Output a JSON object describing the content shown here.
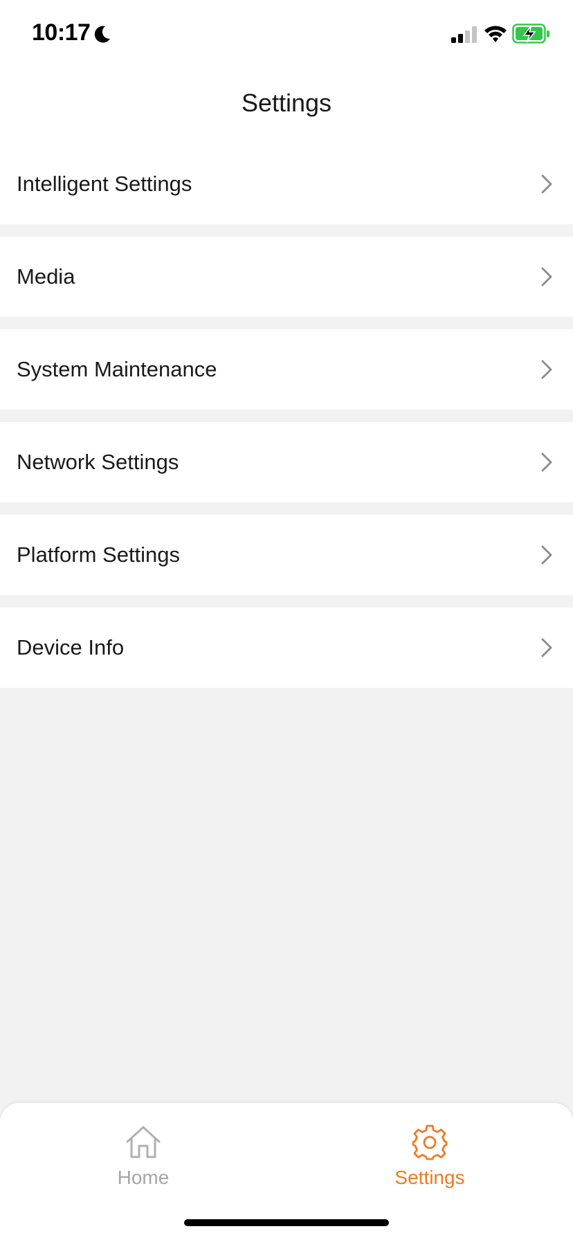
{
  "status_bar": {
    "time": "10:17",
    "icons": [
      "moon-icon",
      "signal-icon",
      "wifi-icon",
      "battery-charging-icon"
    ]
  },
  "header": {
    "title": "Settings"
  },
  "menu": {
    "items": [
      {
        "label": "Intelligent Settings"
      },
      {
        "label": "Media"
      },
      {
        "label": "System Maintenance"
      },
      {
        "label": "Network Settings"
      },
      {
        "label": "Platform Settings"
      },
      {
        "label": "Device Info"
      }
    ]
  },
  "tab_bar": {
    "tabs": [
      {
        "label": "Home",
        "icon": "home-icon",
        "active": false
      },
      {
        "label": "Settings",
        "icon": "gear-icon",
        "active": true
      }
    ]
  },
  "colors": {
    "accent": "#f07a1e",
    "inactive": "#a6a6a6",
    "background": "#f2f2f2",
    "battery": "#32c84b"
  }
}
